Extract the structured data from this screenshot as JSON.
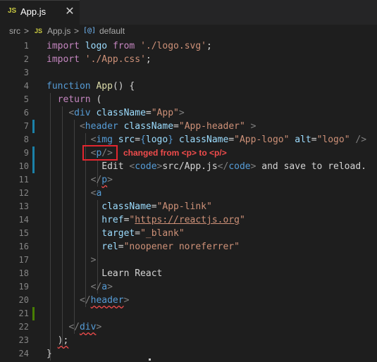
{
  "tab": {
    "icon": "JS",
    "name": "App.js",
    "close": "✕"
  },
  "breadcrumb": {
    "folder": "src",
    "sep1": ">",
    "file_icon": "JS",
    "file": "App.js",
    "sep2": ">",
    "symbol_icon": "[@]",
    "symbol": "default"
  },
  "annotation": "changed from <p> to <p/>",
  "lines": [
    {
      "n": "1",
      "tokens": [
        {
          "t": "import",
          "c": "kw"
        },
        {
          "t": " logo ",
          "c": "var"
        },
        {
          "t": "from",
          "c": "kw"
        },
        {
          "t": " ",
          "c": "plain"
        },
        {
          "t": "'./logo.svg'",
          "c": "str"
        },
        {
          "t": ";",
          "c": "plain"
        }
      ]
    },
    {
      "n": "2",
      "tokens": [
        {
          "t": "import",
          "c": "kw"
        },
        {
          "t": " ",
          "c": "plain"
        },
        {
          "t": "'./App.css'",
          "c": "str"
        },
        {
          "t": ";",
          "c": "plain"
        }
      ]
    },
    {
      "n": "3",
      "tokens": []
    },
    {
      "n": "4",
      "tokens": [
        {
          "t": "function",
          "c": "decl"
        },
        {
          "t": " ",
          "c": "plain"
        },
        {
          "t": "App",
          "c": "fn"
        },
        {
          "t": "() {",
          "c": "plain"
        }
      ]
    },
    {
      "n": "5",
      "tokens": [
        {
          "t": "  ",
          "c": "plain"
        },
        {
          "t": "return",
          "c": "kw"
        },
        {
          "t": " (",
          "c": "plain"
        }
      ]
    },
    {
      "n": "6",
      "tokens": [
        {
          "t": "    ",
          "c": "plain"
        },
        {
          "t": "<",
          "c": "br"
        },
        {
          "t": "div",
          "c": "tag"
        },
        {
          "t": " ",
          "c": "plain"
        },
        {
          "t": "className",
          "c": "attr"
        },
        {
          "t": "=",
          "c": "plain"
        },
        {
          "t": "\"App\"",
          "c": "str"
        },
        {
          "t": ">",
          "c": "br"
        }
      ]
    },
    {
      "n": "7",
      "tokens": [
        {
          "t": "      ",
          "c": "plain"
        },
        {
          "t": "<",
          "c": "br"
        },
        {
          "t": "header",
          "c": "tag"
        },
        {
          "t": " ",
          "c": "plain"
        },
        {
          "t": "className",
          "c": "attr"
        },
        {
          "t": "=",
          "c": "plain"
        },
        {
          "t": "\"App-header\"",
          "c": "str"
        },
        {
          "t": " >",
          "c": "br"
        }
      ]
    },
    {
      "n": "8",
      "tokens": [
        {
          "t": "        ",
          "c": "plain"
        },
        {
          "t": "<",
          "c": "br"
        },
        {
          "t": "img",
          "c": "tag"
        },
        {
          "t": " ",
          "c": "plain"
        },
        {
          "t": "src",
          "c": "attr"
        },
        {
          "t": "=",
          "c": "plain"
        },
        {
          "t": "{",
          "c": "tag"
        },
        {
          "t": "logo",
          "c": "var"
        },
        {
          "t": "}",
          "c": "tag"
        },
        {
          "t": " ",
          "c": "plain"
        },
        {
          "t": "className",
          "c": "attr"
        },
        {
          "t": "=",
          "c": "plain"
        },
        {
          "t": "\"App-logo\"",
          "c": "str"
        },
        {
          "t": " ",
          "c": "plain"
        },
        {
          "t": "alt",
          "c": "attr"
        },
        {
          "t": "=",
          "c": "plain"
        },
        {
          "t": "\"logo\"",
          "c": "str"
        },
        {
          "t": " />",
          "c": "br"
        }
      ]
    },
    {
      "n": "9",
      "tokens": [
        {
          "t": "        ",
          "c": "plain"
        },
        {
          "t": "<",
          "c": "br"
        },
        {
          "t": "p",
          "c": "tag"
        },
        {
          "t": "/>",
          "c": "br"
        }
      ]
    },
    {
      "n": "10",
      "tokens": [
        {
          "t": "          Edit ",
          "c": "plain"
        },
        {
          "t": "<",
          "c": "br"
        },
        {
          "t": "code",
          "c": "tag"
        },
        {
          "t": ">",
          "c": "br"
        },
        {
          "t": "src/App.js",
          "c": "plain"
        },
        {
          "t": "</",
          "c": "br"
        },
        {
          "t": "code",
          "c": "tag"
        },
        {
          "t": ">",
          "c": "br"
        },
        {
          "t": " and save to reload.",
          "c": "plain"
        }
      ]
    },
    {
      "n": "11",
      "tokens": [
        {
          "t": "        ",
          "c": "plain"
        },
        {
          "t": "</",
          "c": "br"
        },
        {
          "t": "p",
          "c": "tag squig"
        },
        {
          "t": ">",
          "c": "br"
        }
      ]
    },
    {
      "n": "12",
      "tokens": [
        {
          "t": "        ",
          "c": "plain"
        },
        {
          "t": "<",
          "c": "br"
        },
        {
          "t": "a",
          "c": "tag"
        }
      ]
    },
    {
      "n": "13",
      "tokens": [
        {
          "t": "          ",
          "c": "plain"
        },
        {
          "t": "className",
          "c": "attr"
        },
        {
          "t": "=",
          "c": "plain"
        },
        {
          "t": "\"App-link\"",
          "c": "str"
        }
      ]
    },
    {
      "n": "14",
      "tokens": [
        {
          "t": "          ",
          "c": "plain"
        },
        {
          "t": "href",
          "c": "attr"
        },
        {
          "t": "=",
          "c": "plain"
        },
        {
          "t": "\"",
          "c": "str"
        },
        {
          "t": "https://reactjs.org",
          "c": "str link"
        },
        {
          "t": "\"",
          "c": "str"
        }
      ]
    },
    {
      "n": "15",
      "tokens": [
        {
          "t": "          ",
          "c": "plain"
        },
        {
          "t": "target",
          "c": "attr"
        },
        {
          "t": "=",
          "c": "plain"
        },
        {
          "t": "\"_blank\"",
          "c": "str"
        }
      ]
    },
    {
      "n": "16",
      "tokens": [
        {
          "t": "          ",
          "c": "plain"
        },
        {
          "t": "rel",
          "c": "attr"
        },
        {
          "t": "=",
          "c": "plain"
        },
        {
          "t": "\"noopener noreferrer\"",
          "c": "str"
        }
      ]
    },
    {
      "n": "17",
      "tokens": [
        {
          "t": "        ",
          "c": "plain"
        },
        {
          "t": ">",
          "c": "br"
        }
      ]
    },
    {
      "n": "18",
      "tokens": [
        {
          "t": "          Learn React",
          "c": "plain"
        }
      ]
    },
    {
      "n": "19",
      "tokens": [
        {
          "t": "        ",
          "c": "plain"
        },
        {
          "t": "</",
          "c": "br"
        },
        {
          "t": "a",
          "c": "tag"
        },
        {
          "t": ">",
          "c": "br"
        }
      ]
    },
    {
      "n": "20",
      "tokens": [
        {
          "t": "      ",
          "c": "plain"
        },
        {
          "t": "</",
          "c": "br"
        },
        {
          "t": "header",
          "c": "tag squig"
        },
        {
          "t": ">",
          "c": "br"
        }
      ]
    },
    {
      "n": "21",
      "tokens": []
    },
    {
      "n": "22",
      "tokens": [
        {
          "t": "    ",
          "c": "plain"
        },
        {
          "t": "</",
          "c": "br"
        },
        {
          "t": "div",
          "c": "tag squig"
        },
        {
          "t": ">",
          "c": "br"
        }
      ]
    },
    {
      "n": "23",
      "tokens": [
        {
          "t": "  ",
          "c": "plain"
        },
        {
          "t": ");",
          "c": "plain squig"
        }
      ]
    },
    {
      "n": "24",
      "tokens": [
        {
          "t": "}",
          "c": "plain"
        }
      ]
    }
  ],
  "modified_lines": [
    "7",
    "9",
    "10"
  ],
  "added_lines": [
    "21"
  ],
  "colors": {
    "modified_marker": "#1b81a8",
    "added_marker": "#487e02",
    "annotation": "#e3262f"
  }
}
